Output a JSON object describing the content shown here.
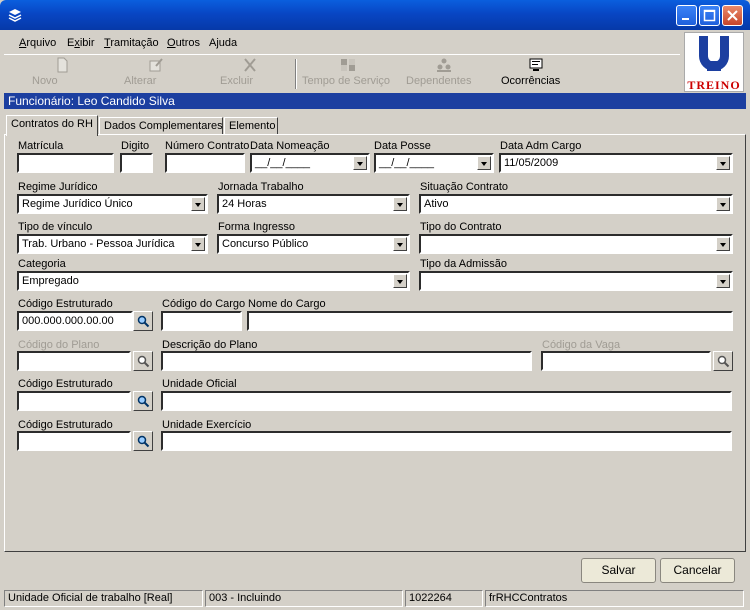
{
  "menu": {
    "items": [
      "Arquivo",
      "Exibir",
      "Tramitação",
      "Outros",
      "Ajuda"
    ]
  },
  "toolbar": {
    "novo": "Novo",
    "alterar": "Alterar",
    "excluir": "Excluir",
    "tempo": "Tempo de Serviço",
    "dependentes": "Dependentes",
    "ocorrencias": "Ocorrências"
  },
  "logo": {
    "text": "TREINO"
  },
  "employee": {
    "label": "Funcionário: Leo Candido Silva"
  },
  "tabs": [
    "Contratos do RH",
    "Dados Complementares",
    "Elemento"
  ],
  "form": {
    "matricula": {
      "label": "Matrícula",
      "value": ""
    },
    "digito": {
      "label": "Digito",
      "value": ""
    },
    "numero_contrato": {
      "label": "Número Contrato",
      "value": ""
    },
    "data_nomeacao": {
      "label": "Data Nomeação",
      "value": "__/__/____"
    },
    "data_posse": {
      "label": "Data Posse",
      "value": "__/__/____"
    },
    "data_adm_cargo": {
      "label": "Data Adm Cargo",
      "value": "11/05/2009"
    },
    "regime": {
      "label": "Regime Jurídico",
      "value": "Regime Jurídico Único"
    },
    "jornada": {
      "label": "Jornada Trabalho",
      "value": "24 Horas"
    },
    "situacao": {
      "label": "Situação Contrato",
      "value": "Ativo"
    },
    "tipo_vinculo": {
      "label": "Tipo de vínculo",
      "value": "Trab. Urbano - Pessoa Jurídica"
    },
    "forma_ingresso": {
      "label": "Forma Ingresso",
      "value": "Concurso Público"
    },
    "tipo_contrato": {
      "label": "Tipo do Contrato",
      "value": ""
    },
    "categoria": {
      "label": "Categoria",
      "value": "Empregado"
    },
    "tipo_admissao": {
      "label": "Tipo da Admissão",
      "value": ""
    },
    "cod_estruturado_1": {
      "label": "Código Estruturado",
      "value": "000.000.000.00.00"
    },
    "codigo_cargo": {
      "label": "Código do Cargo",
      "value": ""
    },
    "nome_cargo": {
      "label": "Nome do Cargo",
      "value": ""
    },
    "codigo_plano": {
      "label": "Código do Plano",
      "value": ""
    },
    "descricao_plano": {
      "label": "Descrição do Plano",
      "value": ""
    },
    "codigo_vaga": {
      "label": "Código da Vaga",
      "value": ""
    },
    "cod_estruturado_2": {
      "label": "Código Estruturado",
      "value": ""
    },
    "unidade_oficial": {
      "label": "Unidade Oficial",
      "value": ""
    },
    "cod_estruturado_3": {
      "label": "Código Estruturado",
      "value": ""
    },
    "unidade_exercicio": {
      "label": "Unidade Exercício",
      "value": ""
    }
  },
  "buttons": {
    "salvar": "Salvar",
    "cancelar": "Cancelar"
  },
  "status": [
    "Unidade Oficial de trabalho [Real]",
    "003 - Incluindo",
    "1022264",
    "frRHCContratos"
  ]
}
